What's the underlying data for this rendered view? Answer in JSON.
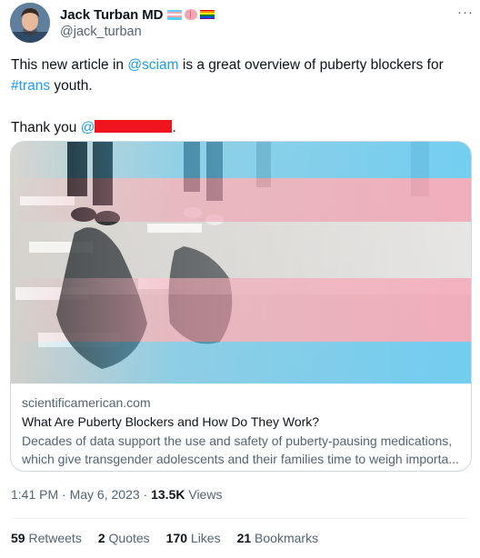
{
  "author": {
    "name": "Jack Turban MD",
    "handle": "@jack_turban",
    "badges": [
      "trans-flag-icon",
      "brain-icon",
      "rainbow-flag-icon"
    ]
  },
  "tweet": {
    "line1_prefix": "This new article in ",
    "mention": "@sciam",
    "line1_mid": " is a great overview of puberty blockers for",
    "hashtag": "#trans",
    "line1_suffix": " youth.",
    "thanks_prefix": "Thank you ",
    "thanks_mention": "@",
    "thanks_suffix": "."
  },
  "card": {
    "domain": "scientificamerican.com",
    "title": "What Are Puberty Blockers and How Do They Work?",
    "desc_line1": "Decades of data support the use and safety of puberty-pausing medications,",
    "desc_line2": "which give transgender adolescents and their families time to weigh importa..."
  },
  "meta": {
    "time": "1:41 PM",
    "date": "May 6, 2023",
    "views_count": "13.5K",
    "views_label": " Views"
  },
  "stats": {
    "retweets_count": "59",
    "retweets_label": " Retweets",
    "quotes_count": "2",
    "quotes_label": " Quotes",
    "likes_count": "170",
    "likes_label": " Likes",
    "bookmarks_count": "21",
    "bookmarks_label": " Bookmarks"
  },
  "colors": {
    "link": "#1d9bf0",
    "secondary_text": "#536471",
    "redaction": "#f0141e",
    "trans_blue": "#5bcefa",
    "trans_pink": "#f5a9b8"
  }
}
